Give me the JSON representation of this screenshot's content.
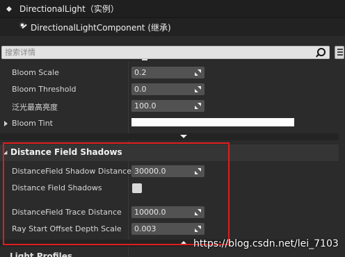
{
  "title_bar": {
    "title": "DirectionalLight（实例）"
  },
  "component": {
    "label": "DirectionalLightComponent (继承)"
  },
  "search": {
    "placeholder": "搜索详情"
  },
  "properties_top": [
    {
      "label": "Bloom Scale",
      "value": "0.2"
    },
    {
      "label": "Bloom Threshold",
      "value": "0.0"
    },
    {
      "label": "泛光最高亮度",
      "value": "100.0"
    }
  ],
  "bloom_tint": {
    "label": "Bloom Tint",
    "color": "#ffffff"
  },
  "category": {
    "title": "Distance Field Shadows"
  },
  "df_properties": {
    "shadow_distance": {
      "label": "DistanceField Shadow Distance",
      "value": "30000.0"
    },
    "shadows_checkbox": {
      "label": "Distance Field Shadows",
      "checked": false
    },
    "trace_distance": {
      "label": "DistanceField Trace Distance",
      "value": "10000.0"
    },
    "ray_offset": {
      "label": "Ray Start Offset Depth Scale",
      "value": "0.003"
    }
  },
  "next_category": {
    "title": "Light Profiles"
  },
  "watermark": {
    "text": "https://blog.csdn.net/lei_7103"
  },
  "colors": {
    "highlight_box": "#e11d1d",
    "panel_bg": "#2b2b2b",
    "field_bg": "#525252"
  }
}
